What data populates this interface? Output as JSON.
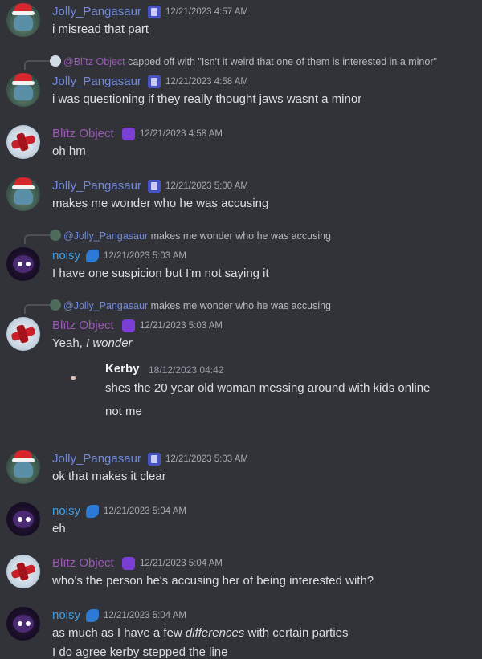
{
  "users": {
    "jolly": "Jolly_Pangasaur",
    "blitz": "Blïtz Object",
    "noisy": "noisy"
  },
  "messages": [
    {
      "author": "Jolly_Pangasaur",
      "time": "12/21/2023 4:57 AM",
      "text": "i misread that part"
    },
    {
      "reply_to": "@Blïtz Object",
      "reply_text": "capped off with \"Isn't it weird that one of them is interested in a minor\"",
      "author": "Jolly_Pangasaur",
      "time": "12/21/2023 4:58 AM",
      "text": "i was questioning if they really thought jaws wasnt a minor"
    },
    {
      "author": "Blïtz Object",
      "time": "12/21/2023 4:58 AM",
      "text": "oh hm"
    },
    {
      "author": "Jolly_Pangasaur",
      "time": "12/21/2023 5:00 AM",
      "text": "makes me wonder who he was accusing"
    },
    {
      "reply_to": "@Jolly_Pangasaur",
      "reply_text": "makes me wonder who he was accusing",
      "author": "noisy",
      "time": "12/21/2023 5:03 AM",
      "text": "I have one suspicion but I'm not saying it"
    },
    {
      "reply_to": "@Jolly_Pangasaur",
      "reply_text": "makes me wonder who he was accusing",
      "author": "Blïtz Object",
      "time": "12/21/2023 5:03 AM",
      "text_plain": "Yeah, ",
      "text_italic": "I wonder"
    },
    {
      "author": "Jolly_Pangasaur",
      "time": "12/21/2023 5:03 AM",
      "text": "ok that makes it clear"
    },
    {
      "author": "noisy",
      "time": "12/21/2023 5:04 AM",
      "text": "eh"
    },
    {
      "author": "Blïtz Object",
      "time": "12/21/2023 5:04 AM",
      "text": "who's the person he's accusing her of being interested with?"
    },
    {
      "author": "noisy",
      "time": "12/21/2023 5:04 AM",
      "text_plain": "as much as I have a few ",
      "text_italic": "differences",
      "text_tail": " with certain parties",
      "text2": "I do agree kerby stepped the line"
    }
  ],
  "embed": {
    "author": "Kerby",
    "time": "18/12/2023 04:42",
    "line1": "shes the 20 year old woman messing around with kids online",
    "line2": "not me"
  }
}
